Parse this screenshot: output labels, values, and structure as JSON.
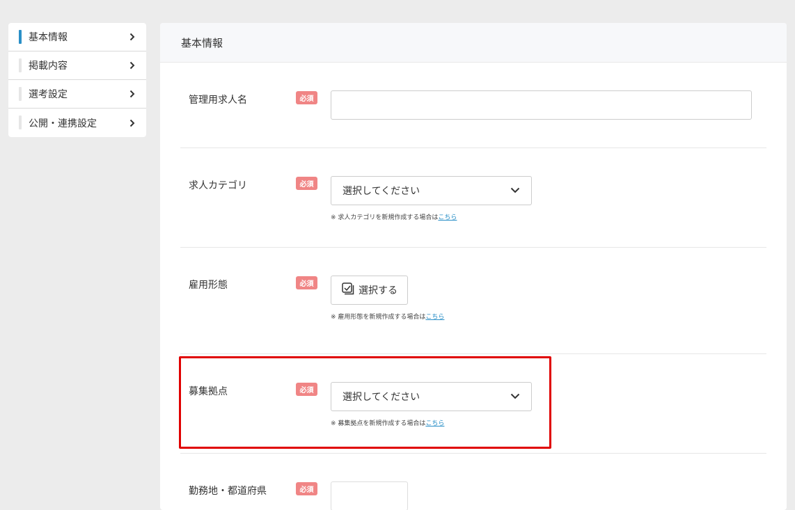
{
  "sidebar": {
    "items": [
      {
        "label": "基本情報",
        "active": true
      },
      {
        "label": "掲載内容",
        "active": false
      },
      {
        "label": "選考設定",
        "active": false
      },
      {
        "label": "公開・連携設定",
        "active": false
      }
    ]
  },
  "panel": {
    "title": "基本情報"
  },
  "required_label": "必須",
  "fields": {
    "job_name": {
      "label": "管理用求人名",
      "value": ""
    },
    "job_category": {
      "label": "求人カテゴリ",
      "selected": "選択してください",
      "note_prefix": "※ 求人カテゴリを新規作成する場合は",
      "note_link": "こちら"
    },
    "employment_type": {
      "label": "雇用形態",
      "button_label": "選択する",
      "note_prefix": "※ 雇用形態を新規作成する場合は",
      "note_link": "こちら"
    },
    "recruit_base": {
      "label": "募集拠点",
      "selected": "選択してください",
      "note_prefix": "※ 募集拠点を新規作成する場合は",
      "note_link": "こちら"
    },
    "work_location": {
      "label": "勤務地・都道府県"
    }
  },
  "colors": {
    "accent": "#2a8fc7",
    "required_badge": "#f08585",
    "highlight": "#e00000"
  }
}
